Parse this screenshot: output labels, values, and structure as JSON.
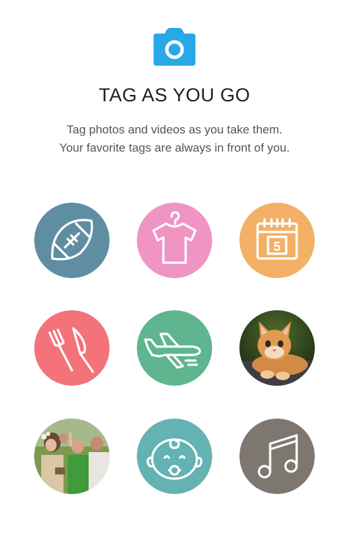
{
  "header": {
    "app_icon": "camera-icon",
    "title": "TAG AS YOU GO",
    "subtitle_line1": "Tag photos and videos as you take them.",
    "subtitle_line2": "Your favorite tags are always in front of you."
  },
  "tags": [
    {
      "name": "football",
      "icon": "football-icon",
      "color": "#5f8ea3"
    },
    {
      "name": "clothing",
      "icon": "tshirt-icon",
      "color": "#ef94c3"
    },
    {
      "name": "calendar",
      "icon": "calendar-icon",
      "value": "5",
      "color": "#f2b166"
    },
    {
      "name": "food",
      "icon": "fork-knife-icon",
      "color": "#f47279"
    },
    {
      "name": "travel",
      "icon": "airplane-icon",
      "color": "#5fb58f"
    },
    {
      "name": "cat",
      "icon": "kitten-photo",
      "color": "#c98540"
    },
    {
      "name": "party",
      "icon": "crowd-photo",
      "color": "#7b9a4e"
    },
    {
      "name": "baby",
      "icon": "baby-face-icon",
      "color": "#64b2b1"
    },
    {
      "name": "music",
      "icon": "music-note-icon",
      "color": "#7e776f"
    }
  ],
  "colors": {
    "accent": "#29a8e8",
    "title": "#1e1e1e",
    "subtitle": "#555555"
  }
}
